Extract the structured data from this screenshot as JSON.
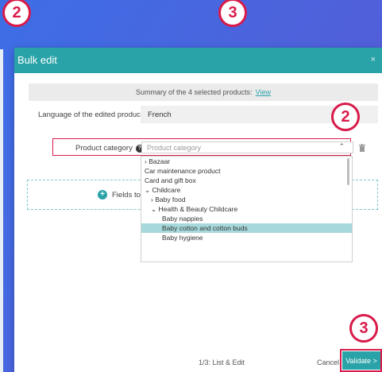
{
  "annotations": {
    "badge_top_left": "2",
    "badge_top_center": "3",
    "badge_category": "2",
    "badge_validate": "3"
  },
  "modal": {
    "title": "Bulk edit",
    "close_symbol": "×",
    "summary_text": "Summary of the 4 selected products:",
    "summary_link": "View",
    "language_label": "Language of the edited products",
    "language_value": "French",
    "category_label": "Product category",
    "category_placeholder": "Product category",
    "category_caret": "⌃",
    "fields_to_edit_label": "Fields to edit",
    "dropdown_items": [
      "› Bazaar",
      "Car maintenance product",
      "Card and gift box",
      "⌄ Childcare",
      "› Baby food",
      "⌄ Health & Beauty Childcare",
      "Baby nappies",
      "Baby cotton and cotton buds",
      "Baby hygiene"
    ],
    "footer_step": "1/3: List & Edit",
    "cancel_label": "Cancel",
    "validate_label": "Validate >"
  },
  "colors": {
    "accent": "#2aa3a8",
    "annotation": "#d81b4a",
    "selected_row": "#a7d9dc"
  },
  "icons": [
    "help-icon",
    "chevron-up-icon",
    "trash-icon",
    "plus-circle-icon",
    "close-icon"
  ]
}
